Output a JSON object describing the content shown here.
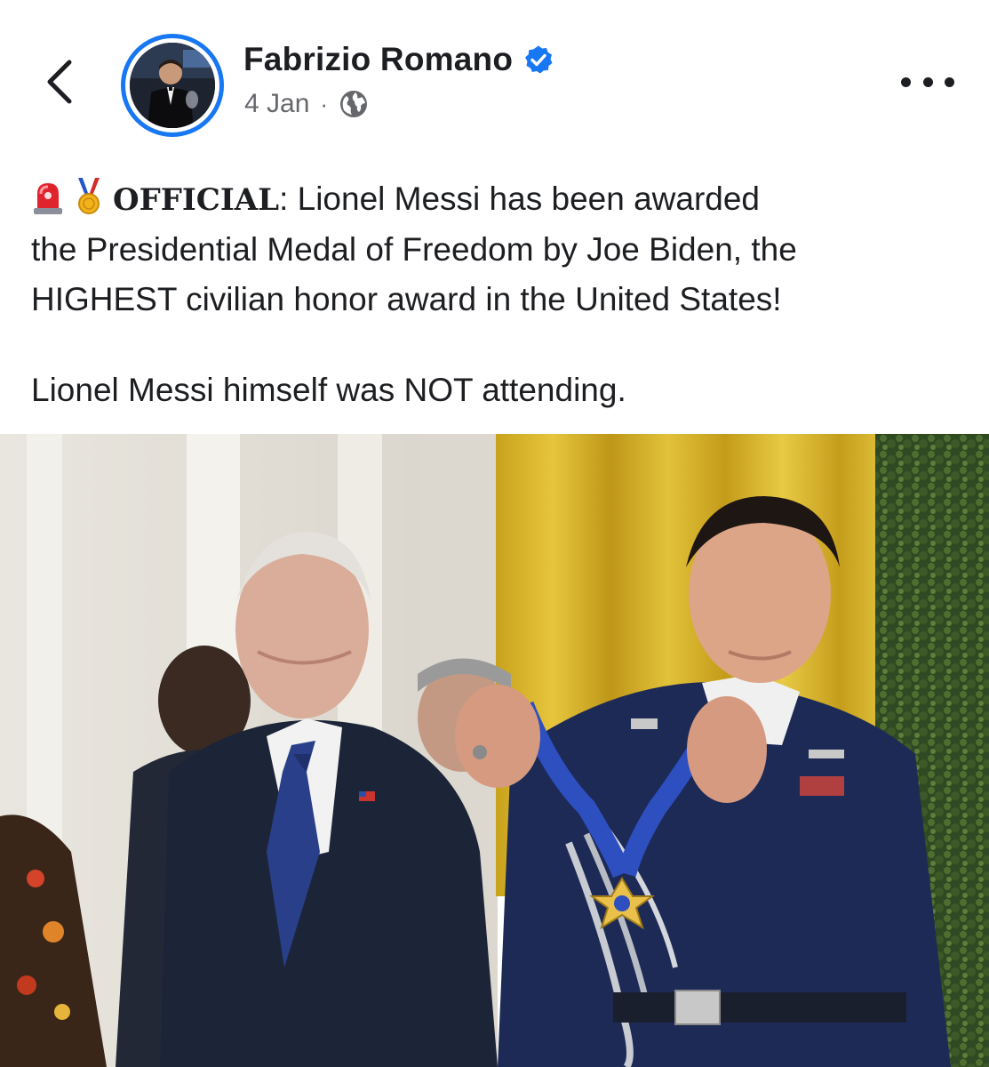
{
  "post": {
    "author_name": "Fabrizio Romano",
    "date": "4 Jan",
    "separator": "·",
    "text": {
      "prefix_bold": "OFFICIAL",
      "line1_rest": ": Lionel Messi has been awarded",
      "line2": "the Presidential Medal of Freedom by Joe Biden, the",
      "line3": "HIGHEST civilian honor award in the United States!",
      "line4": "Lionel Messi himself was NOT attending."
    }
  },
  "icons": {
    "back": "chevron-left-icon",
    "verified": "verified-badge-icon",
    "audience": "globe-icon",
    "more": "more-horizontal-icon",
    "emoji_1": "police-light-emoji",
    "emoji_2": "medal-emoji"
  },
  "colors": {
    "verified_blue": "#1877f2",
    "text_primary": "#1c1e21",
    "text_secondary": "#65676b"
  }
}
